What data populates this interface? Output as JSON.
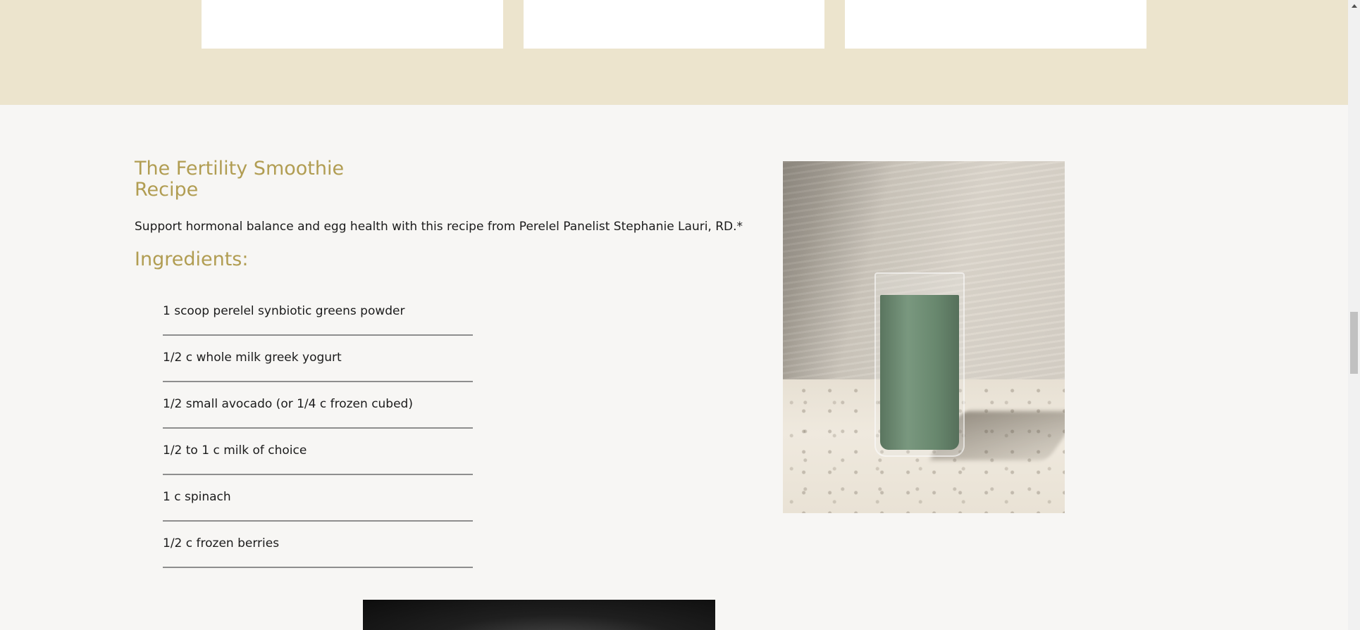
{
  "recipe": {
    "title": "The Fertility Smoothie Recipe",
    "intro": "Support hormonal balance and egg health with this recipe from Perelel Panelist Stephanie Lauri, RD.*",
    "ingredients_heading": "Ingredients:",
    "ingredients": [
      "1 scoop perelel synbiotic greens powder",
      "1/2 c whole milk greek yogurt",
      "1/2 small avocado (or 1/4 c frozen cubed)",
      "1/2 to 1 c milk of choice",
      "1 c spinach",
      "1/2 c frozen berries"
    ]
  },
  "colors": {
    "accent": "#b19d52",
    "top_band": "#ece4cd",
    "page_background": "#f7f6f4",
    "divider": "#8e8e8e",
    "text": "#1b1b1b"
  },
  "images": {
    "smoothie_photo": "green-smoothie-glass-photo",
    "bottom_photo": "dark-product-photo"
  }
}
